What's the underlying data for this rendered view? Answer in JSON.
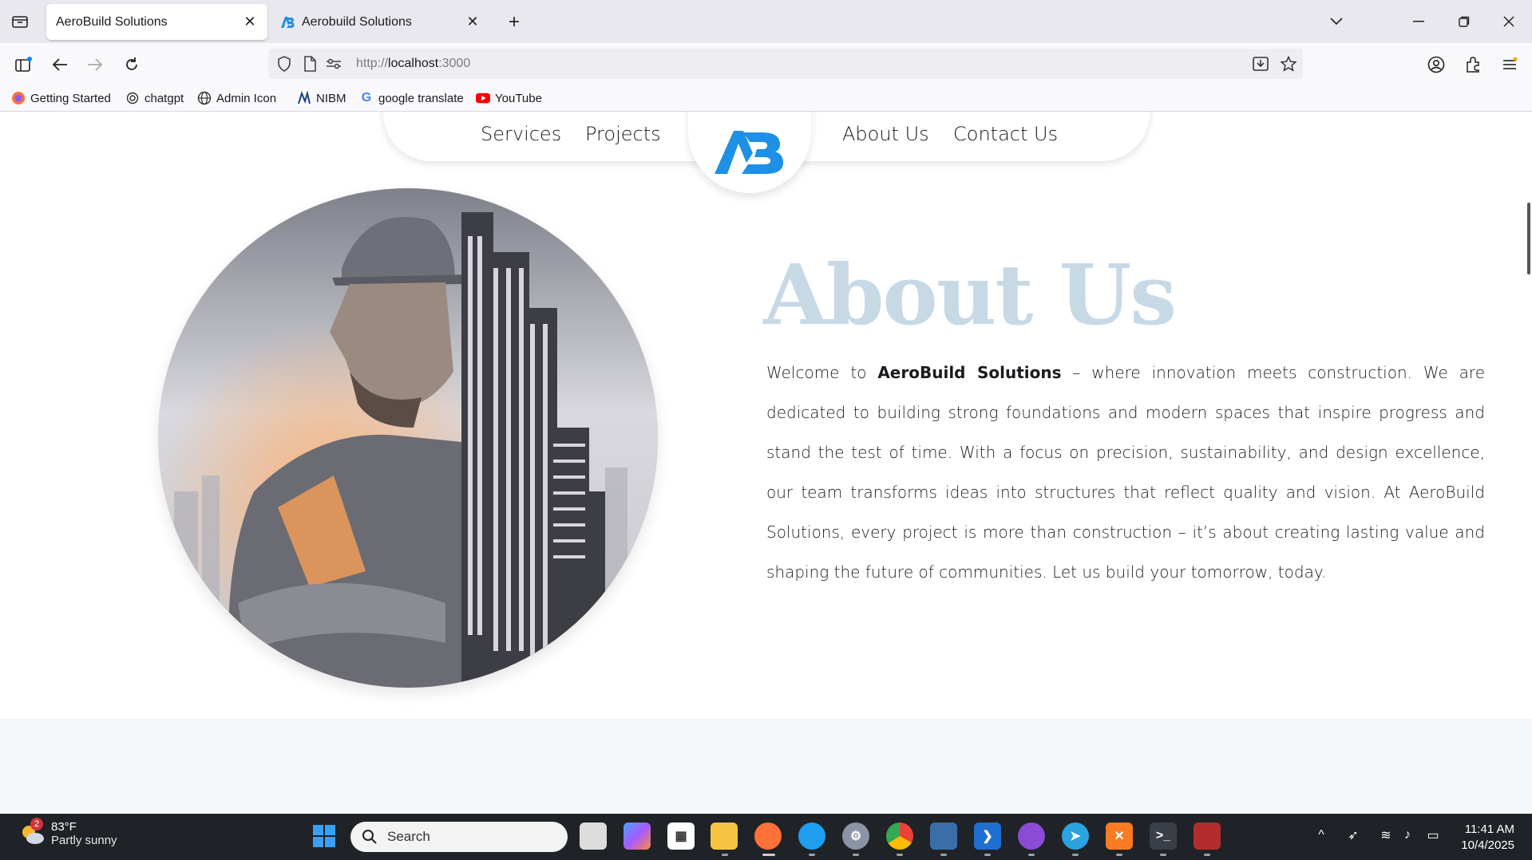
{
  "browser": {
    "tabs": [
      {
        "title": "AeroBuild Solutions",
        "active": true
      },
      {
        "title": "Aerobuild Solutions",
        "active": false
      }
    ],
    "url": {
      "scheme": "http://",
      "host": "localhost",
      "port": ":3000"
    },
    "bookmarks": [
      {
        "label": "Getting Started",
        "icon": "firefox-icon"
      },
      {
        "label": "chatgpt",
        "icon": "openai-icon"
      },
      {
        "label": "Admin Icon",
        "icon": "globe-icon"
      },
      {
        "label": "NIBM",
        "icon": "nibm-icon"
      },
      {
        "label": "google translate",
        "icon": "google-icon"
      },
      {
        "label": "YouTube",
        "icon": "youtube-icon"
      }
    ]
  },
  "site": {
    "nav": {
      "services": "Services",
      "projects": "Projects",
      "about": "About Us",
      "contact": "Contact Us",
      "logo_text": "AB"
    },
    "about": {
      "title": "About Us",
      "intro": "Welcome to ",
      "brand": "AeroBuild Solutions",
      "body": " – where innovation meets construction. We are dedicated to building strong foundations and modern spaces that inspire progress and stand the test of time. With a focus on precision, sustainability, and design excellence, our team transforms ideas into structures that reflect quality and vision. At AeroBuild Solutions, every project is more than construction – it’s about creating lasting value and shaping the future of communities. Let us build your tomorrow, today."
    },
    "colors": {
      "accent": "#1e90e6",
      "title": "#c8d9e6"
    }
  },
  "taskbar": {
    "weather": {
      "badge": "2",
      "temp": "83°F",
      "desc": "Partly sunny"
    },
    "search_placeholder": "Search",
    "time": "11:41 AM",
    "date": "10/4/2025"
  }
}
